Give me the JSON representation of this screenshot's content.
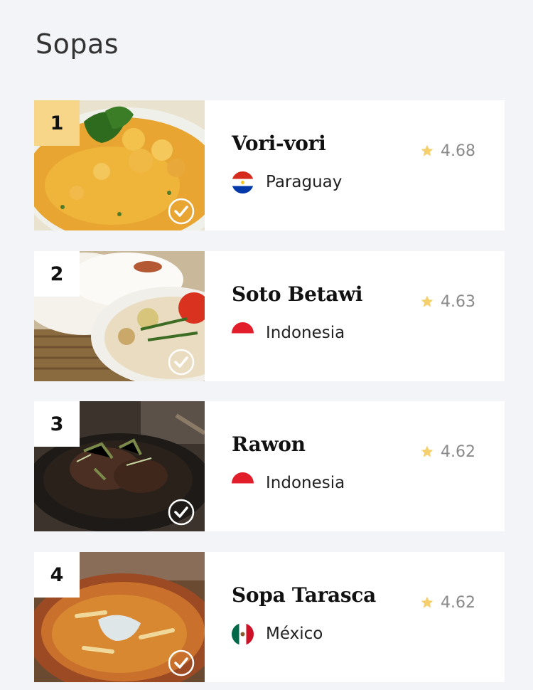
{
  "page": {
    "title": "Sopas"
  },
  "colors": {
    "rank_first_bg": "#f7d589",
    "star": "#f5cf6b",
    "rating_text": "#8a8a8a"
  },
  "dishes": [
    {
      "rank": "1",
      "name": "Vori-vori",
      "country": "Paraguay",
      "flag": "paraguay-flag-icon",
      "rating": "4.68"
    },
    {
      "rank": "2",
      "name": "Soto Betawi",
      "country": "Indonesia",
      "flag": "indonesia-flag-icon",
      "rating": "4.63"
    },
    {
      "rank": "3",
      "name": "Rawon",
      "country": "Indonesia",
      "flag": "indonesia-flag-icon",
      "rating": "4.62"
    },
    {
      "rank": "4",
      "name": "Sopa Tarasca",
      "country": "México",
      "flag": "mexico-flag-icon",
      "rating": "4.62"
    }
  ]
}
